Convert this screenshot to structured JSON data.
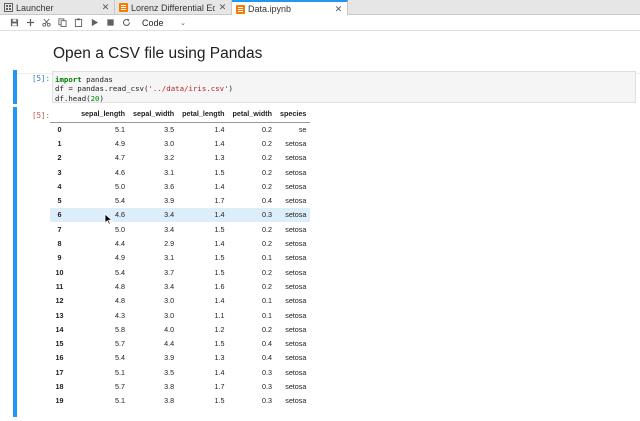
{
  "tabs": [
    {
      "label": "Launcher",
      "icon": "launcher-icon",
      "active": false
    },
    {
      "label": "Lorenz Differential Equatio",
      "icon": "notebook-icon",
      "active": false
    },
    {
      "label": "Data.ipynb",
      "icon": "notebook-icon",
      "active": true
    }
  ],
  "toolbar": {
    "cell_type": "Code",
    "buttons": [
      "save-icon",
      "add-cell-icon",
      "cut-icon",
      "copy-icon",
      "paste-icon",
      "run-icon",
      "stop-icon",
      "restart-icon"
    ]
  },
  "notebook": {
    "markdown_title": "Open a CSV file using Pandas",
    "input_prompt": "[5]:",
    "output_prompt": "[5]:",
    "code": {
      "line1_kw": "import",
      "line1_rest": " pandas",
      "line2_a": "df = pandas.read_csv(",
      "line2_str": "'../data/iris.csv'",
      "line2_b": ")",
      "line3_a": "df.head(",
      "line3_num": "20",
      "line3_b": ")"
    },
    "table": {
      "columns": [
        "",
        "sepal_length",
        "sepal_width",
        "petal_length",
        "petal_width",
        "species"
      ],
      "rows": [
        [
          "0",
          "5.1",
          "3.5",
          "1.4",
          "0.2",
          "se"
        ],
        [
          "1",
          "4.9",
          "3.0",
          "1.4",
          "0.2",
          "setosa"
        ],
        [
          "2",
          "4.7",
          "3.2",
          "1.3",
          "0.2",
          "setosa"
        ],
        [
          "3",
          "4.6",
          "3.1",
          "1.5",
          "0.2",
          "setosa"
        ],
        [
          "4",
          "5.0",
          "3.6",
          "1.4",
          "0.2",
          "setosa"
        ],
        [
          "5",
          "5.4",
          "3.9",
          "1.7",
          "0.4",
          "setosa"
        ],
        [
          "6",
          "4.6",
          "3.4",
          "1.4",
          "0.3",
          "setosa"
        ],
        [
          "7",
          "5.0",
          "3.4",
          "1.5",
          "0.2",
          "setosa"
        ],
        [
          "8",
          "4.4",
          "2.9",
          "1.4",
          "0.2",
          "setosa"
        ],
        [
          "9",
          "4.9",
          "3.1",
          "1.5",
          "0.1",
          "setosa"
        ],
        [
          "10",
          "5.4",
          "3.7",
          "1.5",
          "0.2",
          "setosa"
        ],
        [
          "11",
          "4.8",
          "3.4",
          "1.6",
          "0.2",
          "setosa"
        ],
        [
          "12",
          "4.8",
          "3.0",
          "1.4",
          "0.1",
          "setosa"
        ],
        [
          "13",
          "4.3",
          "3.0",
          "1.1",
          "0.1",
          "setosa"
        ],
        [
          "14",
          "5.8",
          "4.0",
          "1.2",
          "0.2",
          "setosa"
        ],
        [
          "15",
          "5.7",
          "4.4",
          "1.5",
          "0.4",
          "setosa"
        ],
        [
          "16",
          "5.4",
          "3.9",
          "1.3",
          "0.4",
          "setosa"
        ],
        [
          "17",
          "5.1",
          "3.5",
          "1.4",
          "0.3",
          "setosa"
        ],
        [
          "18",
          "5.7",
          "3.8",
          "1.7",
          "0.3",
          "setosa"
        ],
        [
          "19",
          "5.1",
          "3.8",
          "1.5",
          "0.3",
          "setosa"
        ]
      ],
      "highlighted_row": "6"
    }
  },
  "colors": {
    "accent": "#2196f3",
    "highlight": "#ddeefb"
  }
}
